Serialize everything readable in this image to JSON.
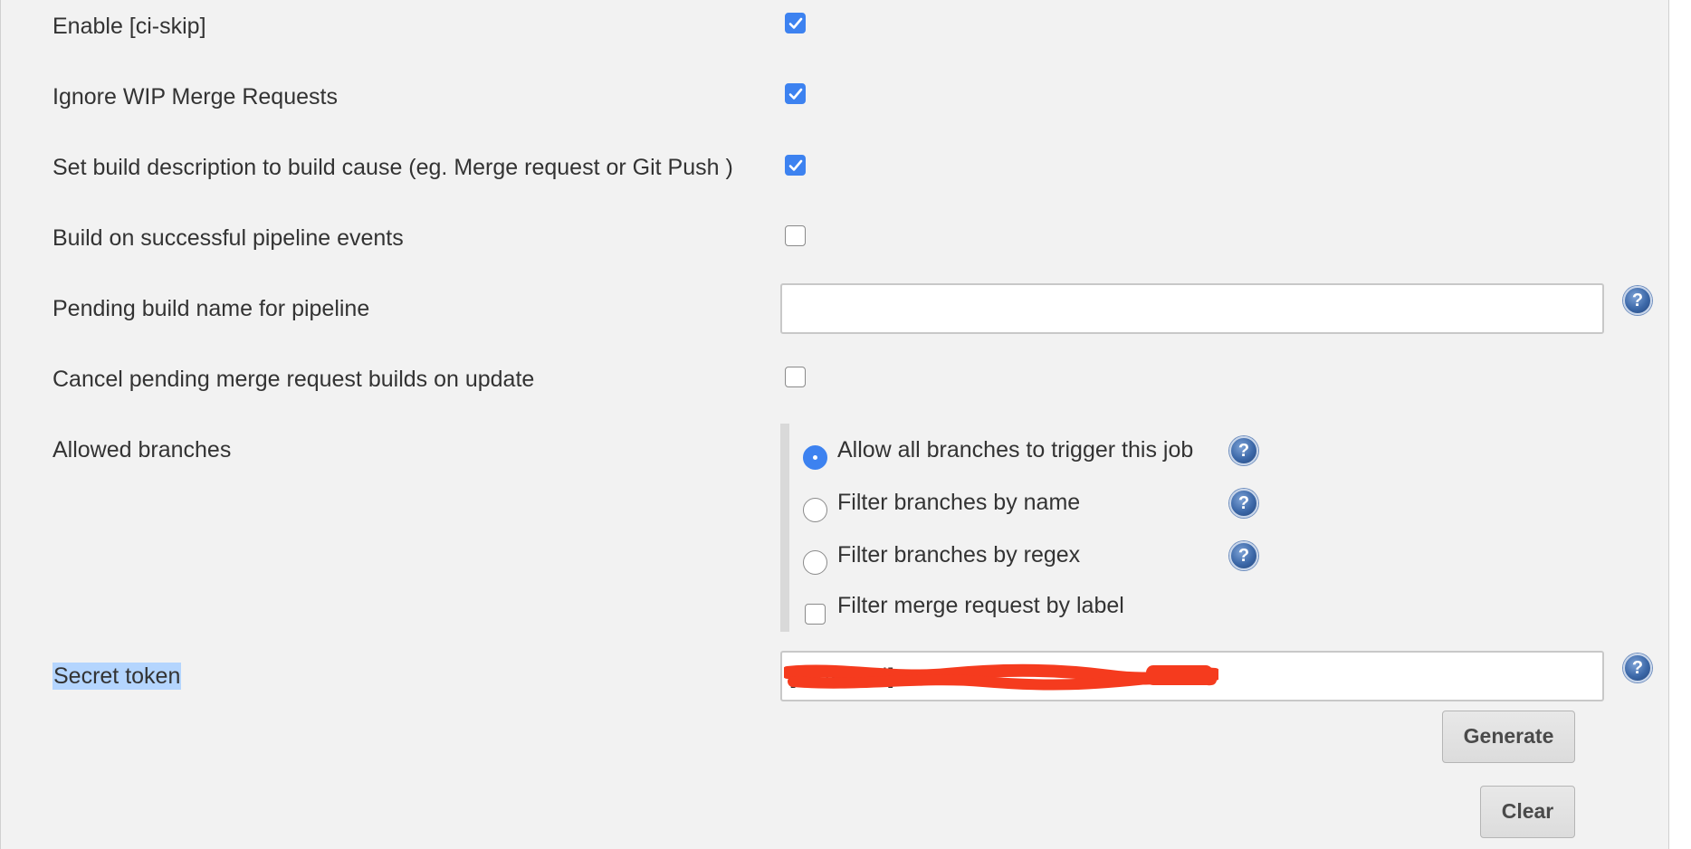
{
  "rows": {
    "ci_skip": {
      "label": "Enable [ci-skip]",
      "checked": true
    },
    "ignore_wip": {
      "label": "Ignore WIP Merge Requests",
      "checked": true
    },
    "build_description": {
      "label": "Set build description to build cause (eg. Merge request or Git Push )",
      "checked": true
    },
    "pipeline_events": {
      "label": "Build on successful pipeline events",
      "checked": false
    },
    "pending_build_name": {
      "label": "Pending build name for pipeline",
      "value": ""
    },
    "cancel_pending": {
      "label": "Cancel pending merge request builds on update",
      "checked": false
    },
    "allowed_branches": {
      "label": "Allowed branches",
      "options": [
        {
          "label": "Allow all branches to trigger this job",
          "selected": true
        },
        {
          "label": "Filter branches by name",
          "selected": false
        },
        {
          "label": "Filter branches by regex",
          "selected": false
        }
      ],
      "label_filter": {
        "label": "Filter merge request by label",
        "checked": false
      }
    },
    "secret_token": {
      "label": "Secret token",
      "value": "[redacted]"
    }
  },
  "buttons": {
    "generate": "Generate",
    "clear": "Clear"
  },
  "icons": {
    "help": "help-icon",
    "redaction": "red-scribble"
  },
  "colors": {
    "accent": "#3d82f0",
    "redaction": "#f53b1e",
    "panel_bg": "#f2f2f2",
    "selection": "#b4d5fe"
  }
}
